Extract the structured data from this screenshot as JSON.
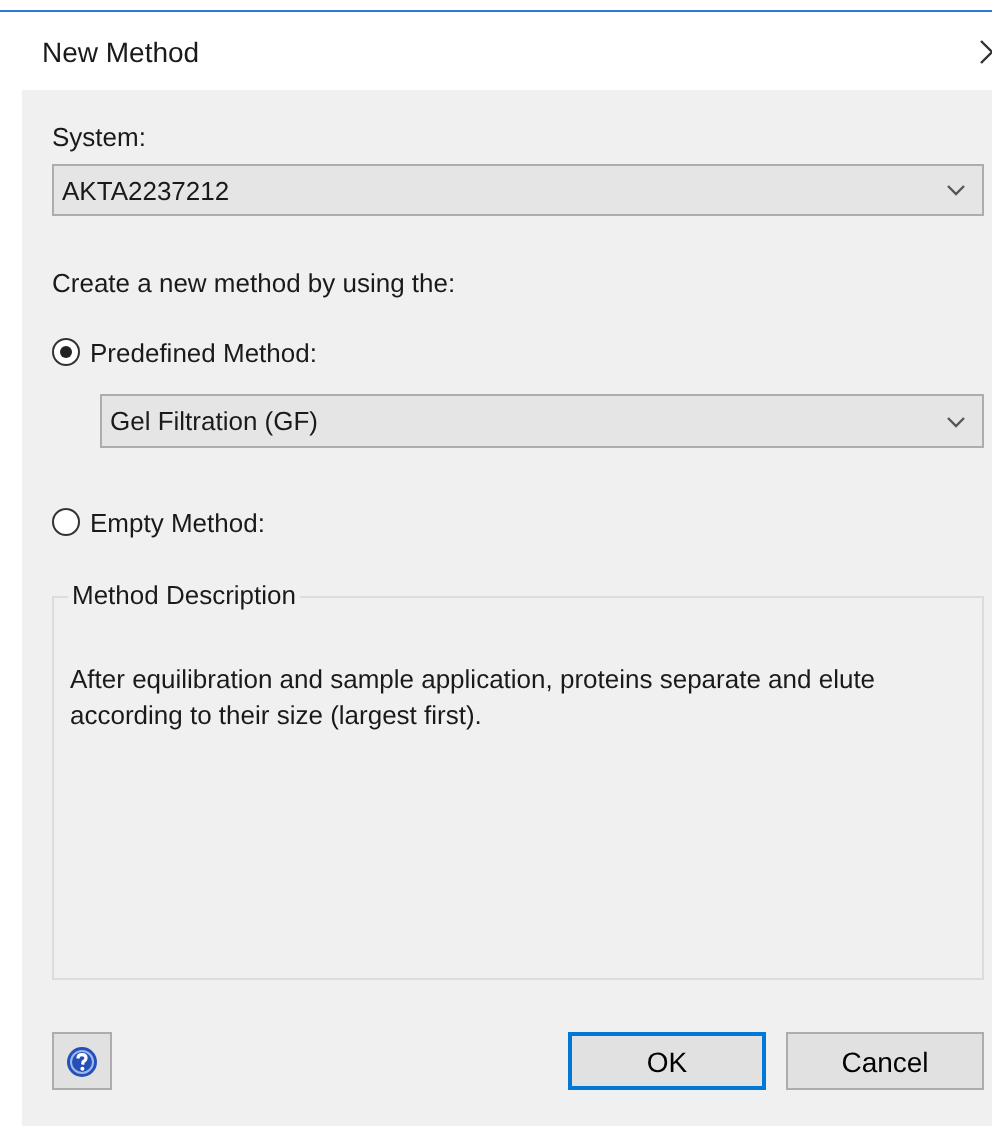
{
  "window": {
    "title": "New Method"
  },
  "system": {
    "label": "System:",
    "value": "AKTA2237212"
  },
  "prompt": "Create a new method by using the:",
  "options": [
    {
      "label": "Predefined Method:",
      "selected": true,
      "kind": "combo",
      "value": "Gel Filtration (GF)"
    },
    {
      "label": "Empty Method:",
      "selected": false,
      "kind": "plain"
    }
  ],
  "description": {
    "legend": "Method Description",
    "text": "After equilibration and sample application, proteins separate and elute according to their size (largest first)."
  },
  "buttons": [
    {
      "label": "OK",
      "default": true
    },
    {
      "label": "Cancel",
      "default": false
    }
  ]
}
